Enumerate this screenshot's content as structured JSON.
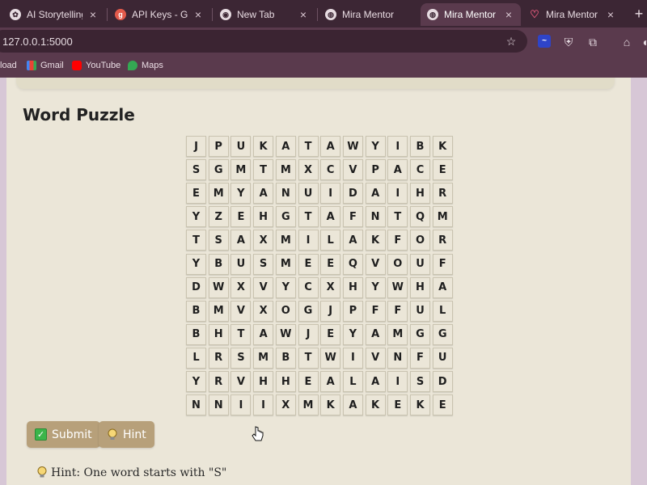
{
  "browser": {
    "tabs": [
      {
        "title": "AI Storytelling W",
        "icon": "openai-icon",
        "color": "#e6dbe1"
      },
      {
        "title": "API Keys - Groq",
        "icon": "groq-icon",
        "color": "#e35a4b"
      },
      {
        "title": "New Tab",
        "icon": "chrome-icon",
        "color": "#e6dbe1"
      },
      {
        "title": "Mira Mentor",
        "icon": "globe-icon",
        "color": "#e6dbe1"
      },
      {
        "title": "Mira Mentor",
        "icon": "globe-icon",
        "color": "#e6dbe1"
      },
      {
        "title": "Mira Mentor ~ C",
        "icon": "heart-icon",
        "color": "#e35a7b"
      }
    ],
    "url": "127.0.0.1:5000",
    "bookmarks": [
      "load",
      "Gmail",
      "YouTube",
      "Maps"
    ]
  },
  "puzzle": {
    "title": "Word Puzzle",
    "grid": [
      [
        "J",
        "P",
        "U",
        "K",
        "A",
        "T",
        "A",
        "W",
        "Y",
        "I",
        "B",
        "K"
      ],
      [
        "S",
        "G",
        "M",
        "T",
        "M",
        "X",
        "C",
        "V",
        "P",
        "A",
        "C",
        "E"
      ],
      [
        "E",
        "M",
        "Y",
        "A",
        "N",
        "U",
        "I",
        "D",
        "A",
        "I",
        "H",
        "R"
      ],
      [
        "Y",
        "Z",
        "E",
        "H",
        "G",
        "T",
        "A",
        "F",
        "N",
        "T",
        "Q",
        "M"
      ],
      [
        "T",
        "S",
        "A",
        "X",
        "M",
        "I",
        "L",
        "A",
        "K",
        "F",
        "O",
        "R"
      ],
      [
        "Y",
        "B",
        "U",
        "S",
        "M",
        "E",
        "E",
        "Q",
        "V",
        "O",
        "U",
        "F"
      ],
      [
        "D",
        "W",
        "X",
        "V",
        "Y",
        "C",
        "X",
        "H",
        "Y",
        "W",
        "H",
        "A"
      ],
      [
        "B",
        "M",
        "V",
        "X",
        "O",
        "G",
        "J",
        "P",
        "F",
        "F",
        "U",
        "L"
      ],
      [
        "B",
        "H",
        "T",
        "A",
        "W",
        "J",
        "E",
        "Y",
        "A",
        "M",
        "G",
        "G"
      ],
      [
        "L",
        "R",
        "S",
        "M",
        "B",
        "T",
        "W",
        "I",
        "V",
        "N",
        "F",
        "U"
      ],
      [
        "Y",
        "R",
        "V",
        "H",
        "H",
        "E",
        "A",
        "L",
        "A",
        "I",
        "S",
        "D"
      ],
      [
        "N",
        "N",
        "I",
        "I",
        "X",
        "M",
        "K",
        "A",
        "K",
        "E",
        "K",
        "E"
      ]
    ],
    "submit_label": "Submit",
    "hint_label": "Hint",
    "hint_text": "Hint: One word starts with \"S\""
  },
  "colors": {
    "button": "#b7a07a",
    "panel": "#ebe6d8",
    "chrome_bg": "#3c2634"
  }
}
